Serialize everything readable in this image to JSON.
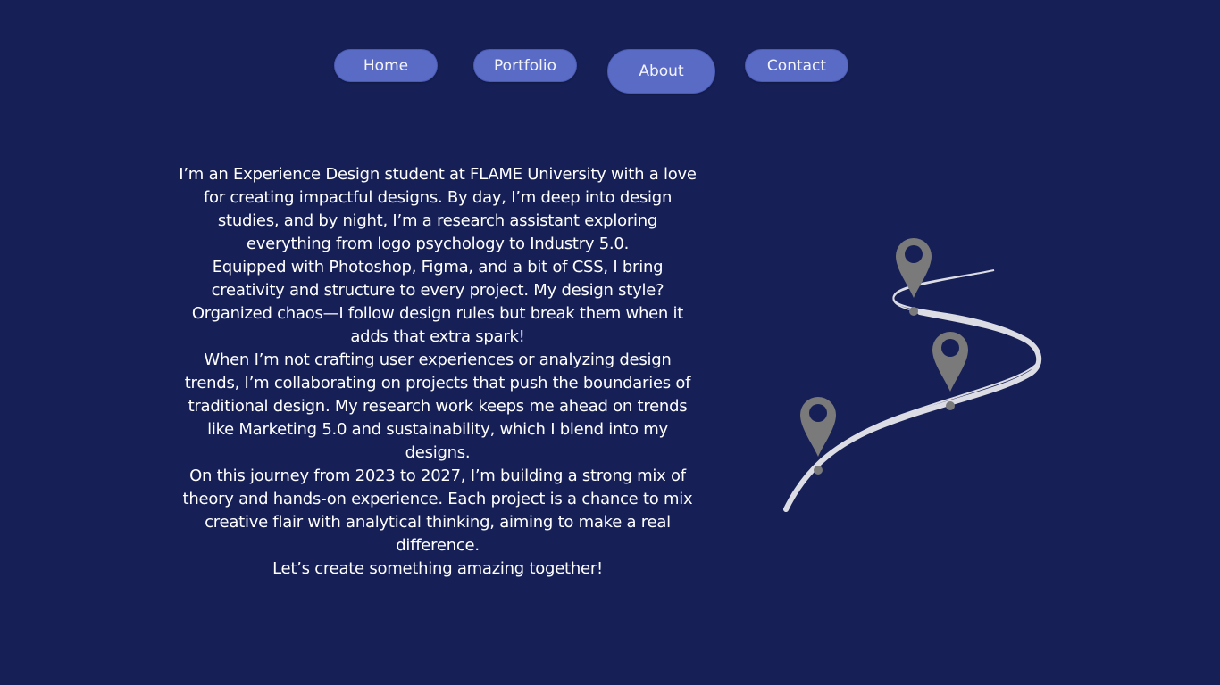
{
  "nav": {
    "home_label": "Home",
    "portfolio_label": "Portfolio",
    "about_label": "About",
    "contact_label": "Contact",
    "active": "About"
  },
  "about": {
    "paragraphs": [
      "I’m an Experience Design student at FLAME University with a love for creating impactful designs. By day, I’m deep into design studies, and by night, I’m a research assistant exploring everything from logo psychology to Industry 5.0.",
      "Equipped with Photoshop, Figma, and a bit of CSS, I bring creativity and structure to every project. My design style? Organized chaos—I follow design rules but break them when it adds that extra spark!",
      "When I’m not crafting user experiences or analyzing design trends, I’m collaborating on projects that push the boundaries of traditional design. My research work keeps me ahead on trends like Marketing 5.0 and sustainability, which I blend into my designs.",
      "On this journey from 2023 to 2027, I’m building a strong mix of theory and hands-on experience. Each project is a chance to mix creative flair with analytical thinking, aiming to make a real difference.",
      "Let’s create something amazing together!"
    ]
  },
  "illustration": {
    "icon": "roadmap-location-pins-icon",
    "pin_count": 3
  },
  "colors": {
    "background": "#162057",
    "button": "#5a6bc6",
    "road": "#dcdce4",
    "pin": "#7a7a7a"
  }
}
